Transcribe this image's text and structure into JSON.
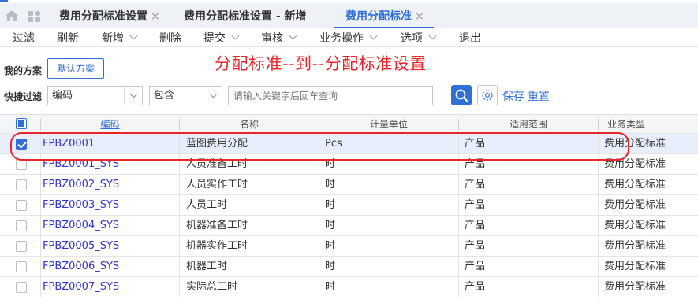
{
  "tabs": [
    {
      "label": "费用分配标准设置",
      "active": false,
      "closable": true
    },
    {
      "label": "费用分配标准设置 - 新增",
      "active": false,
      "closable": false
    },
    {
      "label": "费用分配标准",
      "active": true,
      "closable": true
    }
  ],
  "tab_close_glyph": "×",
  "toolbar": {
    "filter": "过滤",
    "refresh": "刷新",
    "new": "新增",
    "delete": "删除",
    "submit": "提交",
    "audit": "审核",
    "business_ops": "业务操作",
    "options": "选项",
    "exit": "退出"
  },
  "scheme": {
    "label": "我的方案",
    "default_button": "默认方案"
  },
  "annotation": "分配标准--到--分配标准设置",
  "quick_filter": {
    "label": "快捷过滤",
    "field": "编码",
    "operator": "包含",
    "placeholder": "请输入关键字后回车查询",
    "save": "保存",
    "reset": "重置"
  },
  "grid": {
    "headers": {
      "code": "编码",
      "name": "名称",
      "unit": "计量单位",
      "scope": "适用范围",
      "type": "业务类型"
    },
    "rows": [
      {
        "code": "FPBZ0001",
        "name": "蓝图费用分配",
        "unit": "Pcs",
        "scope": "产品",
        "type": "费用分配标准",
        "checked": true
      },
      {
        "code": "FPBZ0001_SYS",
        "name": "人员准备工时",
        "unit": "时",
        "scope": "产品",
        "type": "费用分配标准",
        "checked": false
      },
      {
        "code": "FPBZ0002_SYS",
        "name": "人员实作工时",
        "unit": "时",
        "scope": "产品",
        "type": "费用分配标准",
        "checked": false
      },
      {
        "code": "FPBZ0003_SYS",
        "name": "人员工时",
        "unit": "时",
        "scope": "产品",
        "type": "费用分配标准",
        "checked": false
      },
      {
        "code": "FPBZ0004_SYS",
        "name": "机器准备工时",
        "unit": "时",
        "scope": "产品",
        "type": "费用分配标准",
        "checked": false
      },
      {
        "code": "FPBZ0005_SYS",
        "name": "机器实作工时",
        "unit": "时",
        "scope": "产品",
        "type": "费用分配标准",
        "checked": false
      },
      {
        "code": "FPBZ0006_SYS",
        "name": "机器工时",
        "unit": "时",
        "scope": "产品",
        "type": "费用分配标准",
        "checked": false
      },
      {
        "code": "FPBZ0007_SYS",
        "name": "实际总工时",
        "unit": "时",
        "scope": "产品",
        "type": "费用分配标准",
        "checked": false
      }
    ]
  },
  "colors": {
    "accent": "#2f6fd6",
    "annotation": "#e6262a",
    "code_text": "#2f35c6",
    "selected_row": "#e9eefc"
  },
  "icons": [
    "home-icon",
    "apps-icon",
    "close-icon",
    "chevron-down-icon",
    "search-icon",
    "gear-icon",
    "checkbox-icon"
  ]
}
